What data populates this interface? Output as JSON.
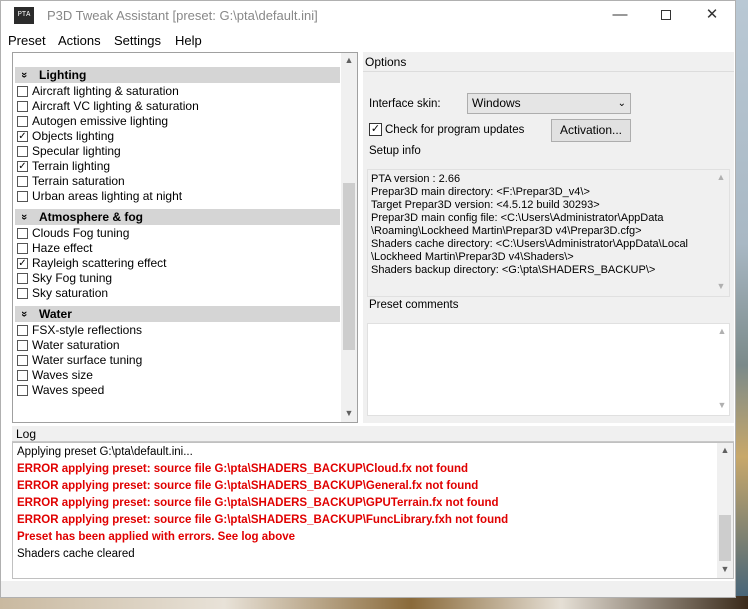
{
  "window": {
    "icon_text": "PTA",
    "title": "P3D Tweak Assistant [preset: G:\\pta\\default.ini]"
  },
  "menu": {
    "items": [
      "Preset",
      "Actions",
      "Settings",
      "Help"
    ]
  },
  "tweaks": {
    "groups": [
      {
        "title": "Lighting",
        "items": [
          {
            "label": "Aircraft lighting & saturation",
            "checked": false
          },
          {
            "label": "Aircraft VC lighting & saturation",
            "checked": false
          },
          {
            "label": "Autogen emissive lighting",
            "checked": false
          },
          {
            "label": "Objects lighting",
            "checked": true
          },
          {
            "label": "Specular lighting",
            "checked": false
          },
          {
            "label": "Terrain lighting",
            "checked": true
          },
          {
            "label": "Terrain saturation",
            "checked": false
          },
          {
            "label": "Urban areas lighting at night",
            "checked": false
          }
        ]
      },
      {
        "title": "Atmosphere & fog",
        "items": [
          {
            "label": "Clouds Fog tuning",
            "checked": false
          },
          {
            "label": "Haze effect",
            "checked": false
          },
          {
            "label": "Rayleigh scattering effect",
            "checked": true
          },
          {
            "label": "Sky Fog tuning",
            "checked": false
          },
          {
            "label": "Sky saturation",
            "checked": false
          }
        ]
      },
      {
        "title": "Water",
        "items": [
          {
            "label": "FSX-style reflections",
            "checked": false
          },
          {
            "label": "Water saturation",
            "checked": false
          },
          {
            "label": "Water surface tuning",
            "checked": false
          },
          {
            "label": "Waves size",
            "checked": false
          },
          {
            "label": "Waves speed",
            "checked": false
          }
        ]
      }
    ]
  },
  "options": {
    "title": "Options",
    "skin_label": "Interface skin:",
    "skin_value": "Windows",
    "updates_label": "Check for program updates",
    "updates_checked": true,
    "activation_button": "Activation...",
    "setup_info_label": "Setup info",
    "setup_info_lines": [
      "PTA version : 2.66",
      "Prepar3D main directory: <F:\\Prepar3D_v4\\>",
      "Target Prepar3D version: <4.5.12 build 30293>",
      "Prepar3D main config file: <C:\\Users\\Administrator\\AppData",
      "\\Roaming\\Lockheed Martin\\Prepar3D v4\\Prepar3D.cfg>",
      "Shaders cache directory: <C:\\Users\\Administrator\\AppData\\Local",
      "\\Lockheed Martin\\Prepar3D v4\\Shaders\\>",
      "Shaders backup directory: <G:\\pta\\SHADERS_BACKUP\\>"
    ],
    "preset_comments_label": "Preset comments",
    "preset_comments_value": ""
  },
  "log": {
    "title": "Log",
    "lines": [
      {
        "text": "Applying preset G:\\pta\\default.ini...",
        "error": false
      },
      {
        "text": "ERROR applying preset: source file G:\\pta\\SHADERS_BACKUP\\Cloud.fx not found",
        "error": true
      },
      {
        "text": "ERROR applying preset: source file G:\\pta\\SHADERS_BACKUP\\General.fx not found",
        "error": true
      },
      {
        "text": "ERROR applying preset: source file G:\\pta\\SHADERS_BACKUP\\GPUTerrain.fx not found",
        "error": true
      },
      {
        "text": "ERROR applying preset: source file G:\\pta\\SHADERS_BACKUP\\FuncLibrary.fxh not found",
        "error": true
      },
      {
        "text": "Preset has been applied with errors. See log above",
        "error": true
      },
      {
        "text": "Shaders cache cleared",
        "error": false
      }
    ]
  },
  "colors": {
    "error_text": "#e00000",
    "group_header_bg": "#d5d5d5",
    "panel_bg": "#f0f0f0"
  }
}
